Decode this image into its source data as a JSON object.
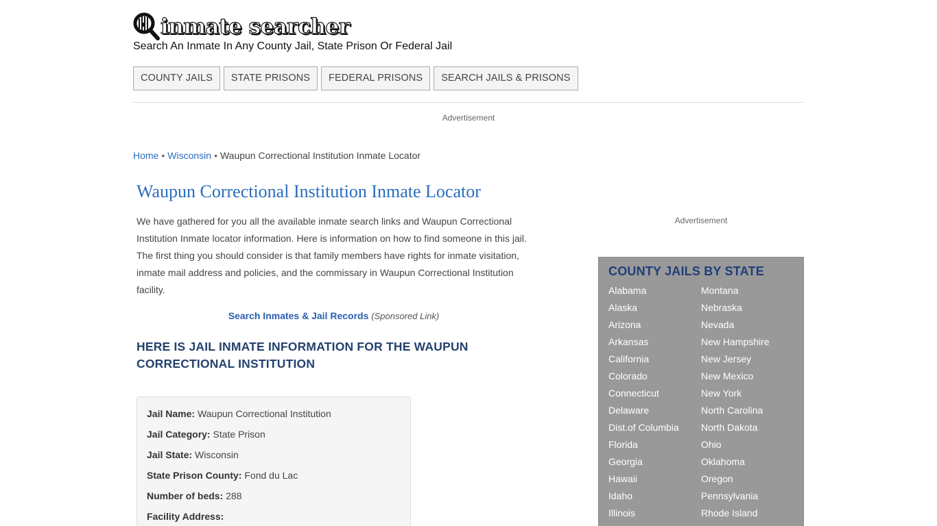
{
  "header": {
    "logo_text": "inmate searcher",
    "tagline": "Search An Inmate In Any County Jail, State Prison Or Federal Jail"
  },
  "nav": [
    "COUNTY JAILS",
    "STATE PRISONS",
    "FEDERAL PRISONS",
    "SEARCH JAILS & PRISONS"
  ],
  "ad_label": "Advertisement",
  "breadcrumb": {
    "home": "Home",
    "sep": "•",
    "state": "Wisconsin",
    "current": "Waupun Correctional Institution Inmate Locator"
  },
  "main": {
    "title": "Waupun Correctional Institution Inmate Locator",
    "intro": "We have gathered for you all the available inmate search links and Waupun Correctional Institution Inmate locator information. Here is information on how to find someone in this jail. The first thing you should consider is that family members have rights for inmate visitation, inmate mail address and policies, and the commissary in Waupun Correctional Institution facility.",
    "sponsored_link": "Search Inmates & Jail Records",
    "sponsored_note": "(Sponsored Link)",
    "section_heading": "HERE IS JAIL INMATE INFORMATION FOR THE WAUPUN CORRECTIONAL INSTITUTION",
    "info": [
      {
        "label": "Jail Name:",
        "value": "Waupun Correctional Institution"
      },
      {
        "label": "Jail Category:",
        "value": "State Prison"
      },
      {
        "label": "Jail State:",
        "value": "Wisconsin"
      },
      {
        "label": "State Prison County:",
        "value": "Fond du Lac"
      },
      {
        "label": "Number of beds:",
        "value": "288"
      },
      {
        "label": "Facility Address:",
        "value": ""
      }
    ]
  },
  "sidebar": {
    "title": "COUNTY JAILS BY STATE",
    "col1": [
      "Alabama",
      "Alaska",
      "Arizona",
      "Arkansas",
      "California",
      "Colorado",
      "Connecticut",
      "Delaware",
      "Dist.of Columbia",
      "Florida",
      "Georgia",
      "Hawaii",
      "Idaho",
      "Illinois"
    ],
    "col2": [
      "Montana",
      "Nebraska",
      "Nevada",
      "New Hampshire",
      "New Jersey",
      "New Mexico",
      "New York",
      "North Carolina",
      "North Dakota",
      "Ohio",
      "Oklahoma",
      "Oregon",
      "Pennsylvania",
      "Rhode Island"
    ]
  },
  "colors": {
    "link": "#2a6ebd",
    "heading": "#24426e",
    "sidebar_bg": "#999999",
    "sidebar_title": "#1f3f7a"
  }
}
